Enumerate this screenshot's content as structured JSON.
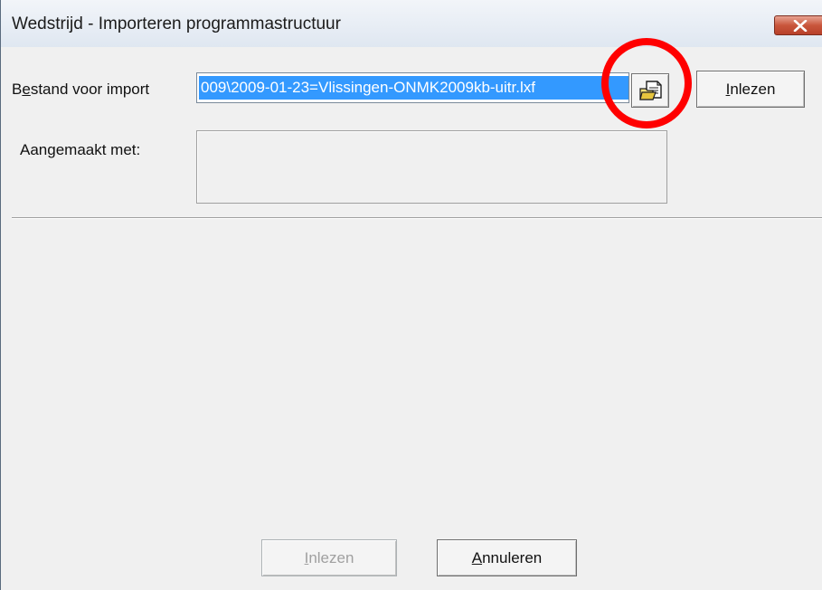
{
  "window": {
    "title": "Wedstrijd - Importeren programmastructuur"
  },
  "form": {
    "file_label": "Bestand voor import",
    "file_path_value": "009\\2009-01-23=Vlissingen-ONMK2009kb-uitr.lxf",
    "created_with_label": "Aangemaakt met:",
    "created_with_value": ""
  },
  "buttons": {
    "read_top": "Inlezen",
    "read_bottom": "Inlezen",
    "cancel": "Annuleren"
  },
  "icons": {
    "close": "close-icon",
    "browse": "folder-open-icon"
  },
  "colors": {
    "selection": "#3399ff",
    "highlight_circle": "#ff0000",
    "close_button": "#c9563c"
  },
  "state": {
    "read_bottom_enabled": false
  }
}
